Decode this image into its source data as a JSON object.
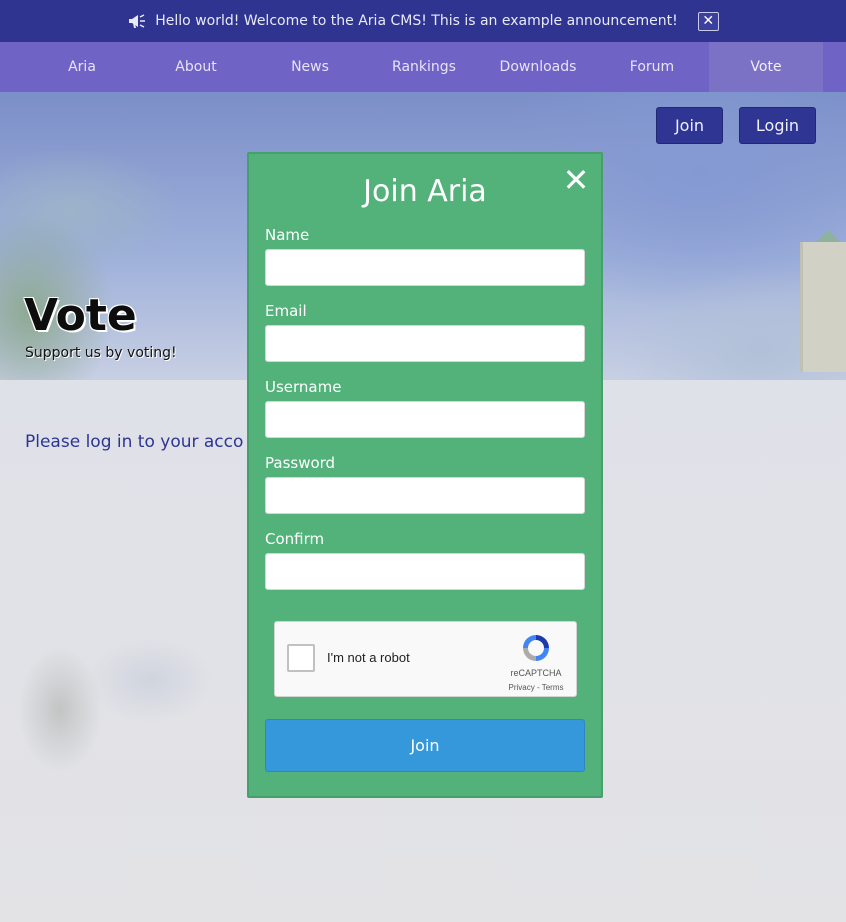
{
  "announcement": {
    "text": "Hello world! Welcome to the Aria CMS! This is an example announcement!",
    "close_label": "✕",
    "icon": "megaphone-icon"
  },
  "nav": {
    "items": [
      {
        "label": "Aria"
      },
      {
        "label": "About"
      },
      {
        "label": "News"
      },
      {
        "label": "Rankings"
      },
      {
        "label": "Downloads"
      },
      {
        "label": "Forum"
      },
      {
        "label": "Vote",
        "active": true
      }
    ]
  },
  "header": {
    "join_label": "Join",
    "login_label": "Login"
  },
  "hero": {
    "title": "Vote",
    "subtitle": "Support us by voting!"
  },
  "main": {
    "message": "Please log in to your acco"
  },
  "modal": {
    "title": "Join Aria",
    "close_label": "✕",
    "fields": [
      {
        "label": "Name",
        "value": ""
      },
      {
        "label": "Email",
        "value": ""
      },
      {
        "label": "Username",
        "value": ""
      },
      {
        "label": "Password",
        "value": ""
      },
      {
        "label": "Confirm",
        "value": ""
      }
    ],
    "captcha": {
      "label": "I'm not a robot",
      "brand": "reCAPTCHA",
      "links": "Privacy - Terms"
    },
    "submit_label": "Join"
  },
  "colors": {
    "announcement_bg": "#2f3490",
    "nav_bg": "#6f63c6",
    "modal_bg": "#52b27a",
    "submit_bg": "#3498db",
    "link_color": "#2d3593"
  }
}
